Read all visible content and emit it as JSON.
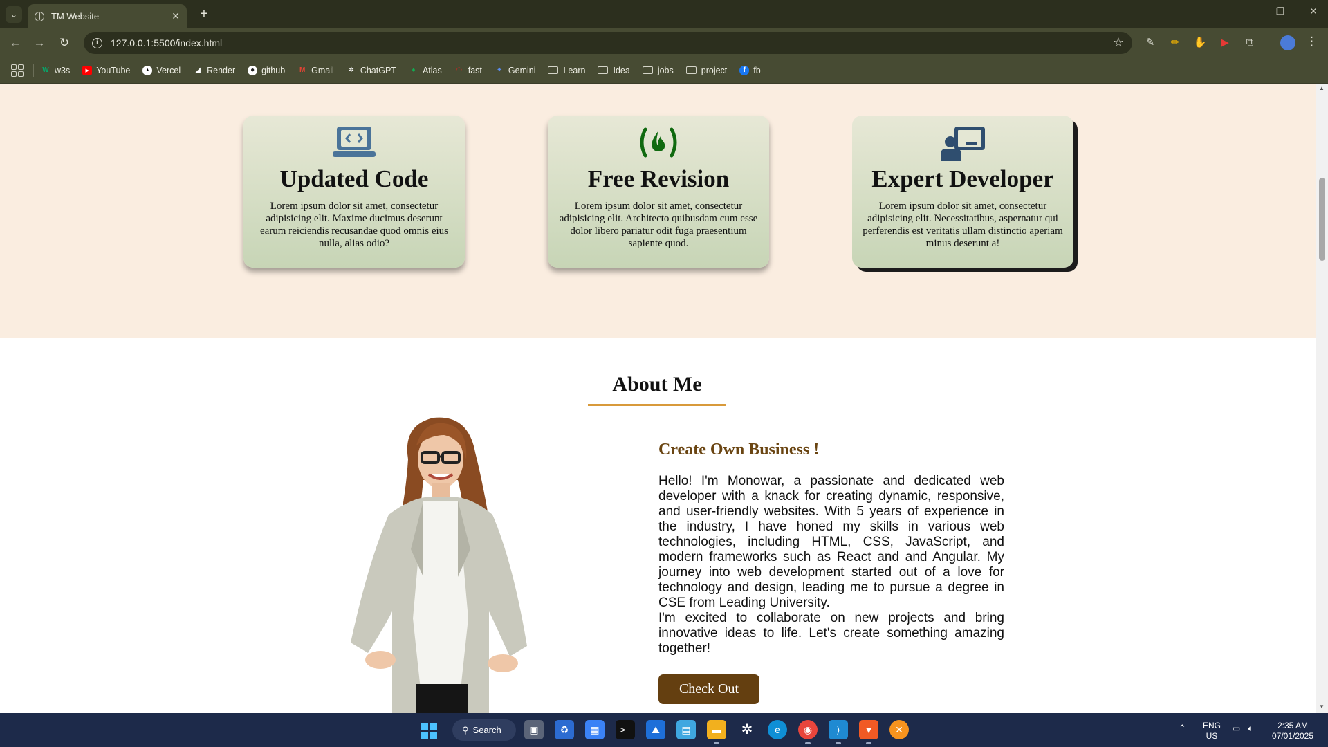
{
  "browser": {
    "tab_title": "TM Website",
    "tab_close": "✕",
    "new_tab": "+",
    "url": "127.0.0.1:5500/index.html",
    "window_controls": [
      "–",
      "❐",
      "✕"
    ],
    "bookmarks": [
      {
        "label": "w3s",
        "icon": "w3s-icon",
        "color": "#04aa6d"
      },
      {
        "label": "YouTube",
        "icon": "youtube-icon",
        "color": "#ff0000"
      },
      {
        "label": "Vercel",
        "icon": "vercel-icon",
        "color": "#ffffff"
      },
      {
        "label": "Render",
        "icon": "render-icon",
        "color": "#111111"
      },
      {
        "label": "github",
        "icon": "github-icon",
        "color": "#ffffff"
      },
      {
        "label": "Gmail",
        "icon": "gmail-icon",
        "color": "#ea4335"
      },
      {
        "label": "ChatGPT",
        "icon": "chatgpt-icon",
        "color": "#ffffff"
      },
      {
        "label": "Atlas",
        "icon": "atlas-icon",
        "color": "#13aa52"
      },
      {
        "label": "fast",
        "icon": "fast-icon",
        "color": "#e02020"
      },
      {
        "label": "Gemini",
        "icon": "gemini-icon",
        "color": "#5b8def"
      }
    ],
    "bookmark_folders": [
      "Learn",
      "Idea",
      "jobs",
      "project"
    ],
    "bookmark_fb": "fb"
  },
  "features": {
    "cards": [
      {
        "icon": "laptop-code-icon",
        "title": "Updated Code",
        "text": "Lorem ipsum dolor sit amet, consectetur adipisicing elit. Maxime ducimus deserunt earum reiciendis recusandae quod omnis eius nulla, alias odio?"
      },
      {
        "icon": "free-code-camp-icon",
        "title": "Free Revision",
        "text": "Lorem ipsum dolor sit amet, consectetur adipisicing elit. Architecto quibusdam cum esse dolor libero pariatur odit fuga praesentium sapiente quod."
      },
      {
        "icon": "chalkboard-user-icon",
        "title": "Expert Developer",
        "text": "Lorem ipsum dolor sit amet, consectetur adipisicing elit. Necessitatibus, aspernatur qui perferendis est veritatis ullam distinctio aperiam minus deserunt a!"
      }
    ],
    "icon_colors": {
      "laptop": "#4a7399",
      "fire": "#106a10",
      "chalkboard": "#2f4e6f"
    }
  },
  "about": {
    "heading": "About Me",
    "subheading": "Create Own Business !",
    "paragraph1": "Hello! I'm Monowar, a passionate and dedicated web developer with a knack for creating dynamic, responsive, and user-friendly websites. With 5 years of experience in the industry, I have honed my skills in various web technologies, including HTML, CSS, JavaScript, and modern frameworks such as React and and Angular. My journey into web development started out of a love for technology and design, leading me to pursue a degree in CSE from Leading University.",
    "paragraph2": "I'm excited to collaborate on new projects and bring innovative ideas to life. Let's create something amazing together!",
    "button": "Check Out",
    "accent_color": "#d89a3b",
    "brand_color": "#643f10"
  },
  "taskbar": {
    "search_label": "Search",
    "language": "ENG",
    "region": "US",
    "time": "2:35 AM",
    "date": "07/01/2025"
  }
}
